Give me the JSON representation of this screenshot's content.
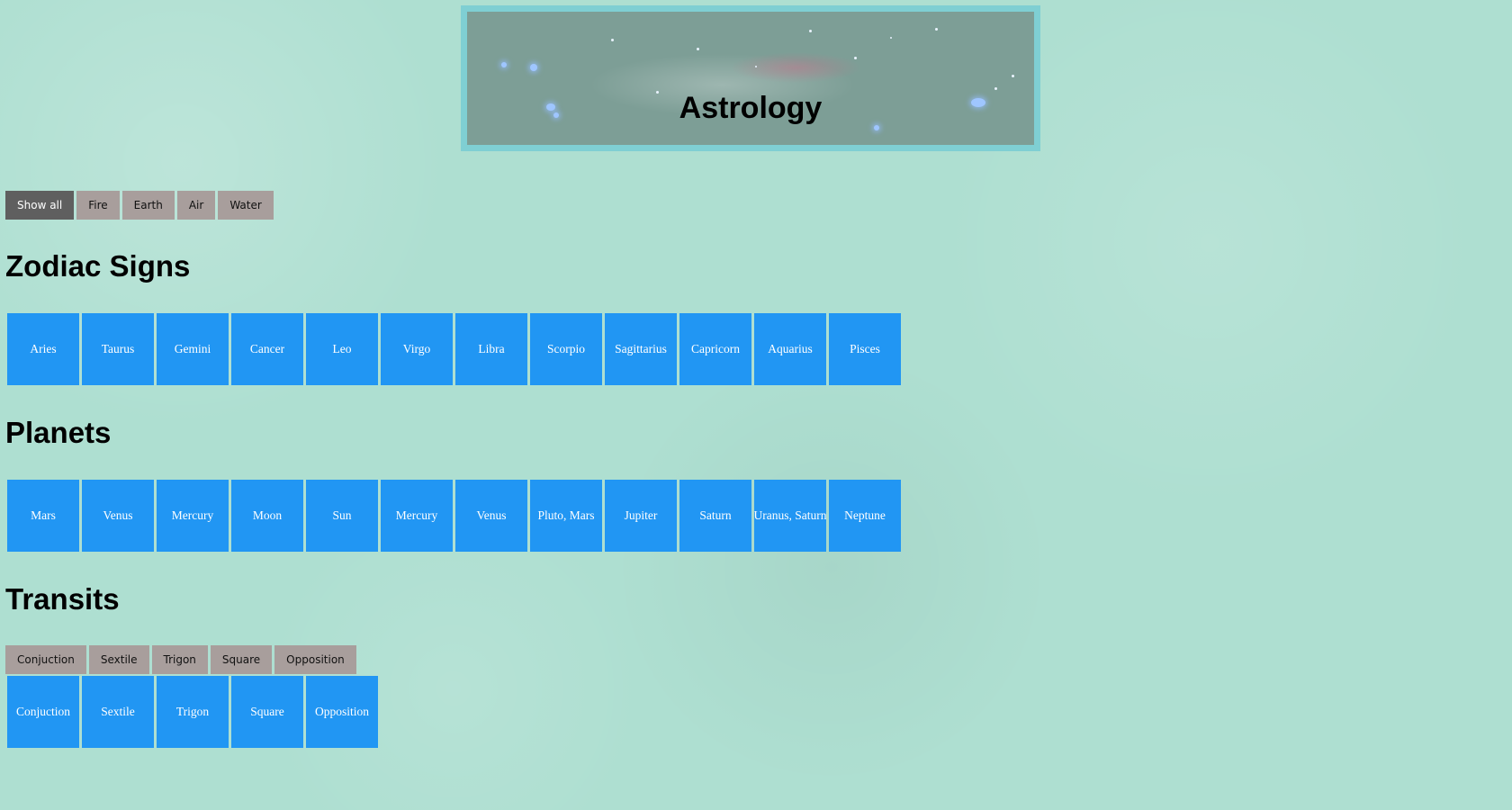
{
  "banner": {
    "title": "Astrology"
  },
  "filters": {
    "items": [
      {
        "label": "Show all",
        "active": true
      },
      {
        "label": "Fire",
        "active": false
      },
      {
        "label": "Earth",
        "active": false
      },
      {
        "label": "Air",
        "active": false
      },
      {
        "label": "Water",
        "active": false
      }
    ]
  },
  "zodiac": {
    "heading": "Zodiac Signs",
    "items": [
      "Aries",
      "Taurus",
      "Gemini",
      "Cancer",
      "Leo",
      "Virgo",
      "Libra",
      "Scorpio",
      "Sagittarius",
      "Capricorn",
      "Aquarius",
      "Pisces"
    ]
  },
  "planets": {
    "heading": "Planets",
    "items": [
      "Mars",
      "Venus",
      "Mercury",
      "Moon",
      "Sun",
      "Mercury",
      "Venus",
      "Pluto, Mars",
      "Jupiter",
      "Saturn",
      "Uranus, Saturn",
      "Neptune"
    ]
  },
  "transits": {
    "heading": "Transits",
    "filters": [
      "Conjuction",
      "Sextile",
      "Trigon",
      "Square",
      "Opposition"
    ],
    "items": [
      "Conjuction",
      "Sextile",
      "Trigon",
      "Square",
      "Opposition"
    ]
  },
  "colors": {
    "background": "#aedfd1",
    "card": "#2196f3",
    "filter_button": "#a89e9c",
    "filter_button_active": "#5f5f5f",
    "banner_border": "#7fcfd3"
  }
}
